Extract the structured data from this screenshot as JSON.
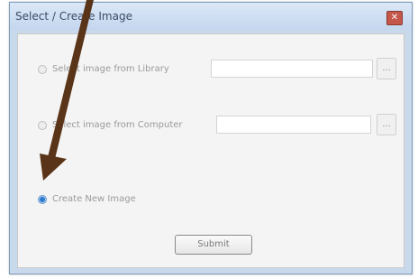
{
  "dialog": {
    "title": "Select / Create Image",
    "close_label": "✕"
  },
  "options": [
    {
      "label": "Select image from Library",
      "selected": false,
      "has_path_field": true,
      "browse_label": "..."
    },
    {
      "label": "Select image from Computer",
      "selected": false,
      "has_path_field": true,
      "browse_label": "..."
    },
    {
      "label": "Create New Image",
      "selected": true,
      "has_path_field": false
    }
  ],
  "buttons": {
    "submit_label": "Submit"
  },
  "annotation": {
    "arrow_color": "#5a3418",
    "icon": "arrow-pointer-icon"
  }
}
